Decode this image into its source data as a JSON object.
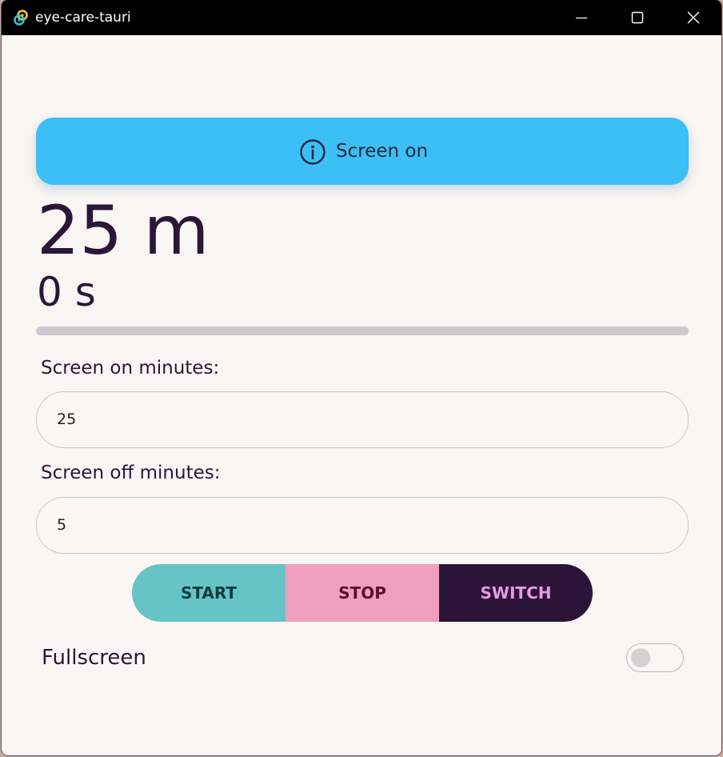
{
  "window": {
    "title": "eye-care-tauri",
    "app_icon": "tauri-logo-icon",
    "controls": [
      "minimize-icon",
      "maximize-icon",
      "close-icon"
    ]
  },
  "status_banner": {
    "icon": "info-icon",
    "text": "Screen on",
    "color": "#3cbef7"
  },
  "timer": {
    "minutes_text": "25 m",
    "seconds_text": "0 s",
    "progress": 0
  },
  "settings": {
    "screen_on_label": "Screen on minutes:",
    "screen_on_value": "25",
    "screen_off_label": "Screen off minutes:",
    "screen_off_value": "5"
  },
  "actions": {
    "start_label": "START",
    "stop_label": "STOP",
    "switch_label": "SWITCH",
    "colors": {
      "start": "#67c4c6",
      "stop": "#ef9fbd",
      "switch": "#2c1438"
    }
  },
  "fullscreen": {
    "label": "Fullscreen",
    "enabled": false
  }
}
